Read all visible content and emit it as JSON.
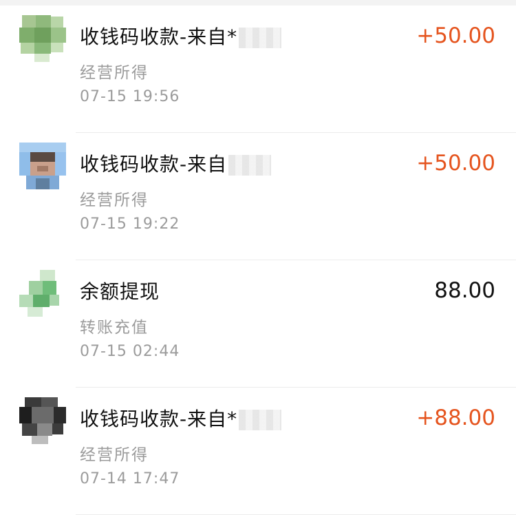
{
  "transactions": [
    {
      "title": "收钱码收款-来自*",
      "category": "经营所得",
      "time": "07-15  19:56",
      "amount": "+50.00",
      "direction": "in",
      "avatar_icon": "avatar-green"
    },
    {
      "title": "收钱码收款-来自",
      "category": "经营所得",
      "time": "07-15  19:22",
      "amount": "+50.00",
      "direction": "in",
      "avatar_icon": "avatar-blue-person"
    },
    {
      "title": "余额提现",
      "category": "转账充值",
      "time": "07-15  02:44",
      "amount": "88.00",
      "direction": "neutral",
      "avatar_icon": "avatar-green-leaf"
    },
    {
      "title": "收钱码收款-来自*",
      "category": "经营所得",
      "time": "07-14  17:47",
      "amount": "+88.00",
      "direction": "in",
      "avatar_icon": "avatar-dark"
    }
  ],
  "colors": {
    "income": "#e5541e",
    "neutral": "#111111",
    "secondary_text": "#9b9b9b"
  }
}
